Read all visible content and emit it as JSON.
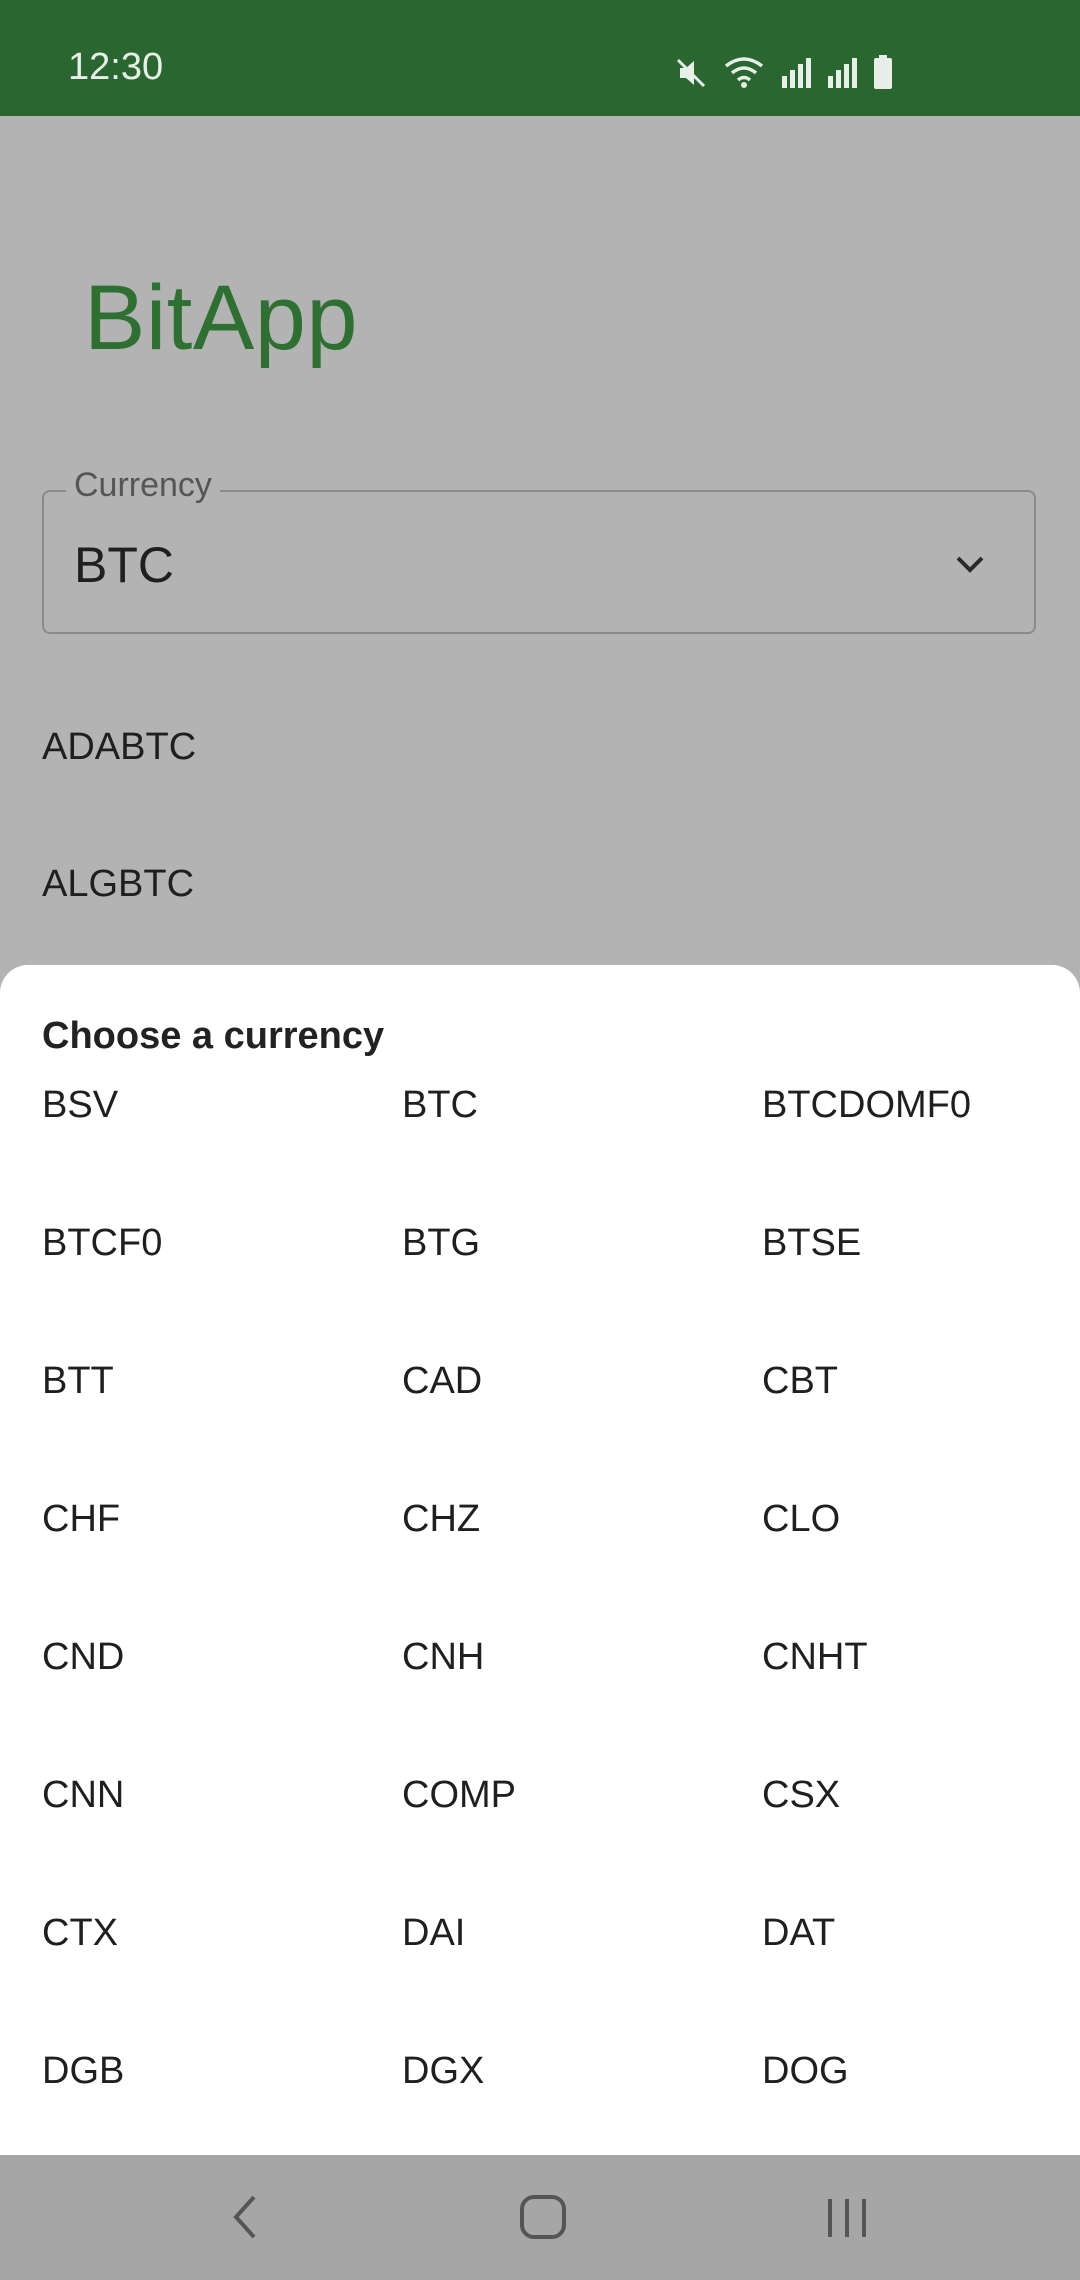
{
  "status_bar": {
    "time": "12:30",
    "icons": [
      "mute-icon",
      "wifi-icon",
      "signal-icon",
      "signal-icon-2",
      "battery-icon"
    ]
  },
  "app": {
    "title": "BitApp",
    "currency_field": {
      "label": "Currency",
      "value": "BTC"
    },
    "pairs": [
      "ADABTC",
      "ALGBTC"
    ]
  },
  "sheet": {
    "title": "Choose a currency",
    "rows": [
      [
        "BSV",
        "BTC",
        "BTCDOMF0"
      ],
      [
        "BTCF0",
        "BTG",
        "BTSE"
      ],
      [
        "BTT",
        "CAD",
        "CBT"
      ],
      [
        "CHF",
        "CHZ",
        "CLO"
      ],
      [
        "CND",
        "CNH",
        "CNHT"
      ],
      [
        "CNN",
        "COMP",
        "CSX"
      ],
      [
        "CTX",
        "DAI",
        "DAT"
      ],
      [
        "DGB",
        "DGX",
        "DOG"
      ]
    ]
  },
  "nav_bar": {
    "icons": [
      "back-icon",
      "home-icon",
      "recents-icon"
    ]
  },
  "colors": {
    "status_bar": "#2a6630",
    "brand": "#2e7031",
    "scrim": "#b3b3b3",
    "sheet": "#ffffff"
  }
}
